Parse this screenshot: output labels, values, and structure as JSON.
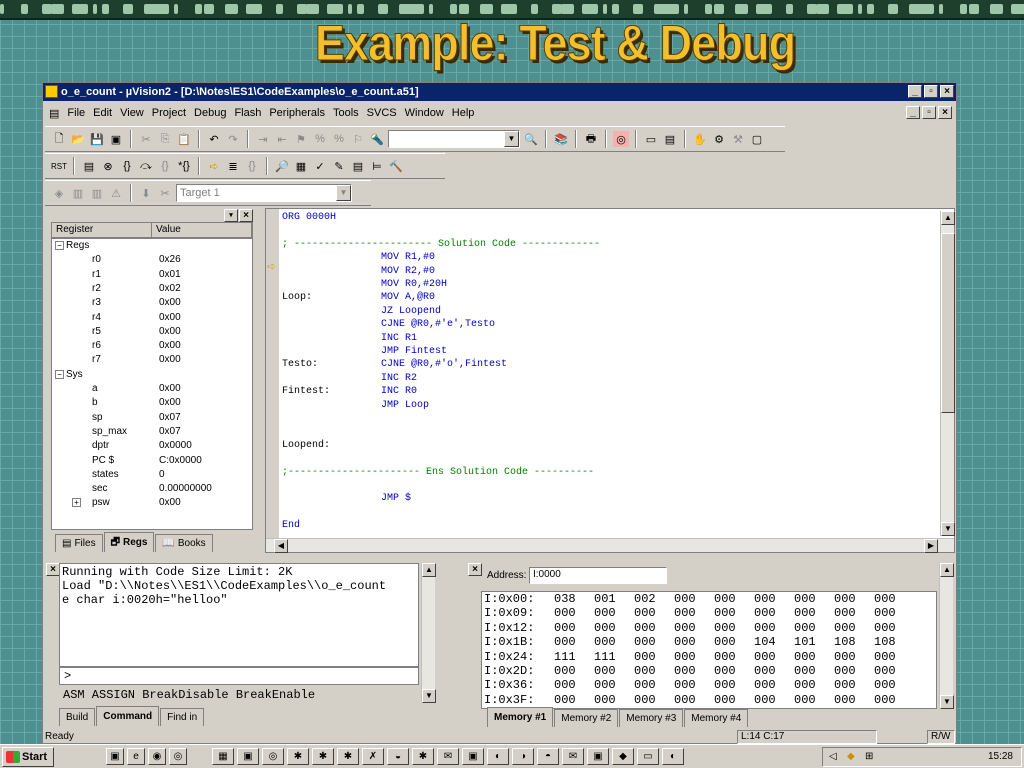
{
  "slide": {
    "title": "Example: Test & Debug"
  },
  "window": {
    "title": "o_e_count - µVision2 - [D:\\Notes\\ES1\\CodeExamples\\o_e_count.a51]"
  },
  "menu": [
    "File",
    "Edit",
    "View",
    "Project",
    "Debug",
    "Flash",
    "Peripherals",
    "Tools",
    "SVCS",
    "Window",
    "Help"
  ],
  "toolbar": {
    "target": "Target 1"
  },
  "registers": {
    "headers": {
      "register": "Register",
      "value": "Value"
    },
    "regs_group": "Regs",
    "regs": [
      {
        "name": "r0",
        "value": "0x26"
      },
      {
        "name": "r1",
        "value": "0x01"
      },
      {
        "name": "r2",
        "value": "0x02"
      },
      {
        "name": "r3",
        "value": "0x00"
      },
      {
        "name": "r4",
        "value": "0x00"
      },
      {
        "name": "r5",
        "value": "0x00"
      },
      {
        "name": "r6",
        "value": "0x00"
      },
      {
        "name": "r7",
        "value": "0x00"
      }
    ],
    "sys_group": "Sys",
    "sys": [
      {
        "name": "a",
        "value": "0x00"
      },
      {
        "name": "b",
        "value": "0x00"
      },
      {
        "name": "sp",
        "value": "0x07"
      },
      {
        "name": "sp_max",
        "value": "0x07"
      },
      {
        "name": "dptr",
        "value": "0x0000"
      },
      {
        "name": "PC $",
        "value": "C:0x0000"
      },
      {
        "name": "states",
        "value": "0"
      },
      {
        "name": "sec",
        "value": "0.00000000"
      },
      {
        "name": "psw",
        "value": "0x00"
      }
    ],
    "tabs": [
      "Files",
      "Regs",
      "Books"
    ]
  },
  "code": [
    {
      "label": "",
      "text": "ORG 0000H"
    },
    {
      "label": "",
      "text": ""
    },
    {
      "label": "",
      "text": "; ----------------------- Solution Code -------------"
    },
    {
      "label": "",
      "text": "MOV R1,#0"
    },
    {
      "label": "",
      "text": "MOV R2,#0"
    },
    {
      "label": "",
      "text": "MOV R0,#20H"
    },
    {
      "label": "Loop:",
      "text": "MOV A,@R0"
    },
    {
      "label": "",
      "text": "JZ Loopend"
    },
    {
      "label": "",
      "text": "CJNE @R0,#'e',Testo"
    },
    {
      "label": "",
      "text": "INC R1"
    },
    {
      "label": "",
      "text": "JMP Fintest"
    },
    {
      "label": "Testo:",
      "text": "CJNE @R0,#'o',Fintest"
    },
    {
      "label": "",
      "text": "INC R2"
    },
    {
      "label": "Fintest:",
      "text": "INC R0"
    },
    {
      "label": "",
      "text": "JMP Loop"
    },
    {
      "label": "",
      "text": ""
    },
    {
      "label": "",
      "text": ""
    },
    {
      "label": "Loopend:",
      "text": ""
    },
    {
      "label": "",
      "text": ""
    },
    {
      "label": "",
      "text": ";---------------------- Ens Solution Code ----------"
    },
    {
      "label": "",
      "text": ""
    },
    {
      "label": "",
      "text": "JMP $"
    },
    {
      "label": "",
      "text": ""
    },
    {
      "label": "",
      "text": "End"
    }
  ],
  "output": {
    "lines": [
      "Running with Code Size Limit: 2K",
      "Load \"D:\\\\Notes\\\\ES1\\\\CodeExamples\\\\o_e_count",
      "e char i:0020h=\"helloo\""
    ],
    "prompt": ">",
    "hint": "ASM ASSIGN BreakDisable BreakEnable",
    "tabs": [
      "Build",
      "Command",
      "Find in"
    ]
  },
  "memory": {
    "address_label": "Address:",
    "address_value": "I:0000",
    "rows": [
      {
        "addr": "I:0x00:",
        "vals": [
          "038",
          "001",
          "002",
          "000",
          "000",
          "000",
          "000",
          "000",
          "000"
        ]
      },
      {
        "addr": "I:0x09:",
        "vals": [
          "000",
          "000",
          "000",
          "000",
          "000",
          "000",
          "000",
          "000",
          "000"
        ]
      },
      {
        "addr": "I:0x12:",
        "vals": [
          "000",
          "000",
          "000",
          "000",
          "000",
          "000",
          "000",
          "000",
          "000"
        ]
      },
      {
        "addr": "I:0x1B:",
        "vals": [
          "000",
          "000",
          "000",
          "000",
          "000",
          "104",
          "101",
          "108",
          "108"
        ]
      },
      {
        "addr": "I:0x24:",
        "vals": [
          "111",
          "111",
          "000",
          "000",
          "000",
          "000",
          "000",
          "000",
          "000"
        ]
      },
      {
        "addr": "I:0x2D:",
        "vals": [
          "000",
          "000",
          "000",
          "000",
          "000",
          "000",
          "000",
          "000",
          "000"
        ]
      },
      {
        "addr": "I:0x36:",
        "vals": [
          "000",
          "000",
          "000",
          "000",
          "000",
          "000",
          "000",
          "000",
          "000"
        ]
      },
      {
        "addr": "I:0x3F:",
        "vals": [
          "000",
          "000",
          "000",
          "000",
          "000",
          "000",
          "000",
          "000",
          "000"
        ]
      }
    ],
    "tabs": [
      "Memory #1",
      "Memory #2",
      "Memory #3",
      "Memory #4"
    ]
  },
  "status": {
    "left": "Ready",
    "position": "L:14 C:17",
    "mode": "R/W"
  },
  "taskbar": {
    "start": "Start",
    "clock": "15:28"
  }
}
